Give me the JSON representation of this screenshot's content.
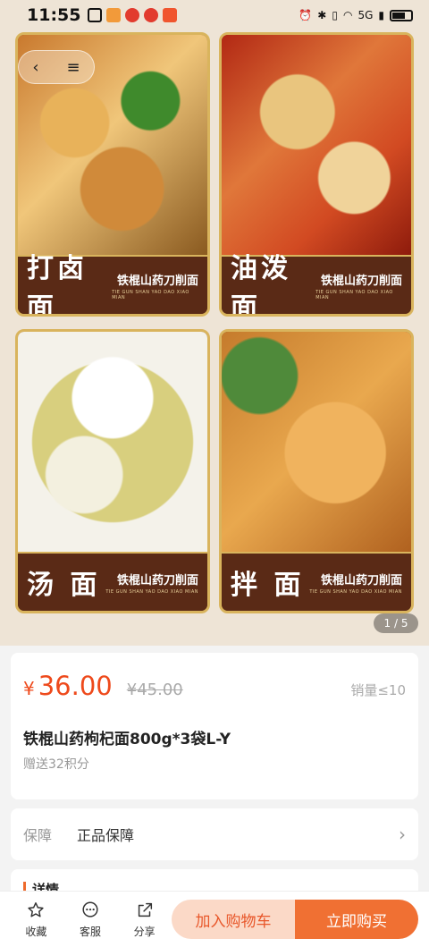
{
  "status": {
    "time": "11:55",
    "network": "5G"
  },
  "gallery": {
    "tiles": [
      {
        "dish": "打卤面",
        "brand": "铁棍山药刀削面",
        "brand_en": "TIE GUN SHAN YAO DAO XIAO MIAN"
      },
      {
        "dish": "油泼面",
        "brand": "铁棍山药刀削面",
        "brand_en": "TIE GUN SHAN YAO DAO XIAO MIAN"
      },
      {
        "dish": "汤 面",
        "brand": "铁棍山药刀削面",
        "brand_en": "TIE GUN SHAN YAO DAO XIAO MIAN"
      },
      {
        "dish": "拌 面",
        "brand": "铁棍山药刀削面",
        "brand_en": "TIE GUN SHAN YAO DAO XIAO MIAN"
      }
    ],
    "pager": "1 / 5"
  },
  "product": {
    "currency": "¥",
    "price": "36.00",
    "original_price": "¥45.00",
    "sales": "销量≤10",
    "title": "铁棍山药枸杞面800g*3袋L-Y",
    "points": "赠送32积分"
  },
  "guarantee": {
    "label": "保障",
    "value": "正品保障"
  },
  "detail": {
    "title": "详情"
  },
  "bottom": {
    "favorite": "收藏",
    "service": "客服",
    "share": "分享",
    "add_cart": "加入购物车",
    "buy_now": "立即购买"
  },
  "colors": {
    "accent": "#ee4a1c",
    "buy": "#f07033",
    "cart_bg": "#fbd9c7",
    "tile_border": "#d9b45d"
  }
}
